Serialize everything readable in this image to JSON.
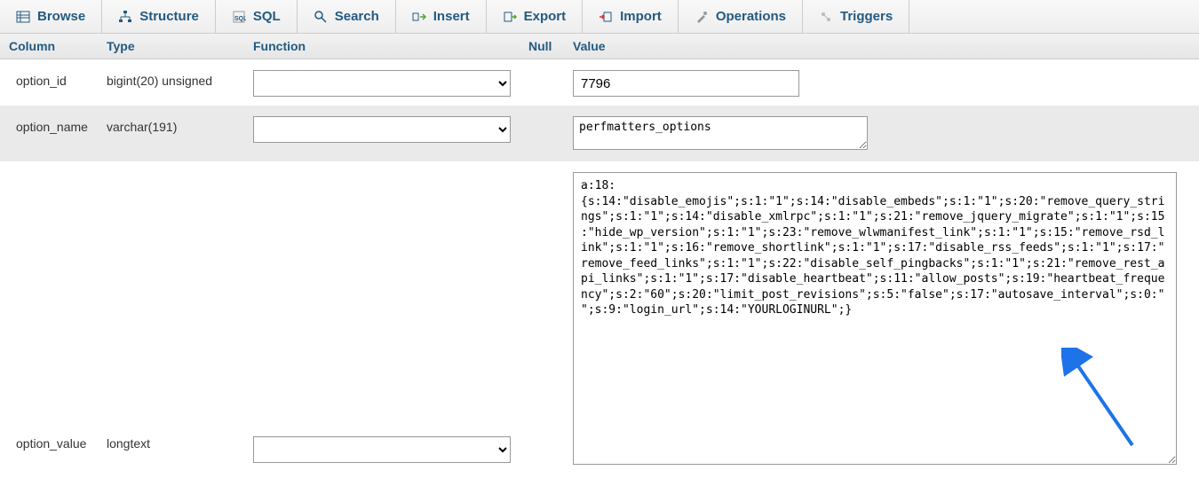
{
  "tabs": [
    {
      "label": "Browse",
      "icon": "browse"
    },
    {
      "label": "Structure",
      "icon": "structure"
    },
    {
      "label": "SQL",
      "icon": "sql"
    },
    {
      "label": "Search",
      "icon": "search"
    },
    {
      "label": "Insert",
      "icon": "insert"
    },
    {
      "label": "Export",
      "icon": "export"
    },
    {
      "label": "Import",
      "icon": "import"
    },
    {
      "label": "Operations",
      "icon": "operations"
    },
    {
      "label": "Triggers",
      "icon": "triggers"
    }
  ],
  "headers": {
    "column": "Column",
    "type": "Type",
    "function": "Function",
    "null": "Null",
    "value": "Value"
  },
  "rows": [
    {
      "column": "option_id",
      "type": "bigint(20) unsigned",
      "value": "7796",
      "input_kind": "text"
    },
    {
      "column": "option_name",
      "type": "varchar(191)",
      "value": "perfmatters_options",
      "input_kind": "small_textarea"
    },
    {
      "column": "option_value",
      "type": "longtext",
      "value": "a:18:{s:14:\"disable_emojis\";s:1:\"1\";s:14:\"disable_embeds\";s:1:\"1\";s:20:\"remove_query_strings\";s:1:\"1\";s:14:\"disable_xmlrpc\";s:1:\"1\";s:21:\"remove_jquery_migrate\";s:1:\"1\";s:15:\"hide_wp_version\";s:1:\"1\";s:23:\"remove_wlwmanifest_link\";s:1:\"1\";s:15:\"remove_rsd_link\";s:1:\"1\";s:16:\"remove_shortlink\";s:1:\"1\";s:17:\"disable_rss_feeds\";s:1:\"1\";s:17:\"remove_feed_links\";s:1:\"1\";s:22:\"disable_self_pingbacks\";s:1:\"1\";s:21:\"remove_rest_api_links\";s:1:\"1\";s:17:\"disable_heartbeat\";s:11:\"allow_posts\";s:19:\"heartbeat_frequency\";s:2:\"60\";s:20:\"limit_post_revisions\";s:5:\"false\";s:17:\"autosave_interval\";s:0:\"\";s:9:\"login_url\";s:14:\"YOURLOGINURL\";}",
      "input_kind": "big_textarea"
    }
  ]
}
